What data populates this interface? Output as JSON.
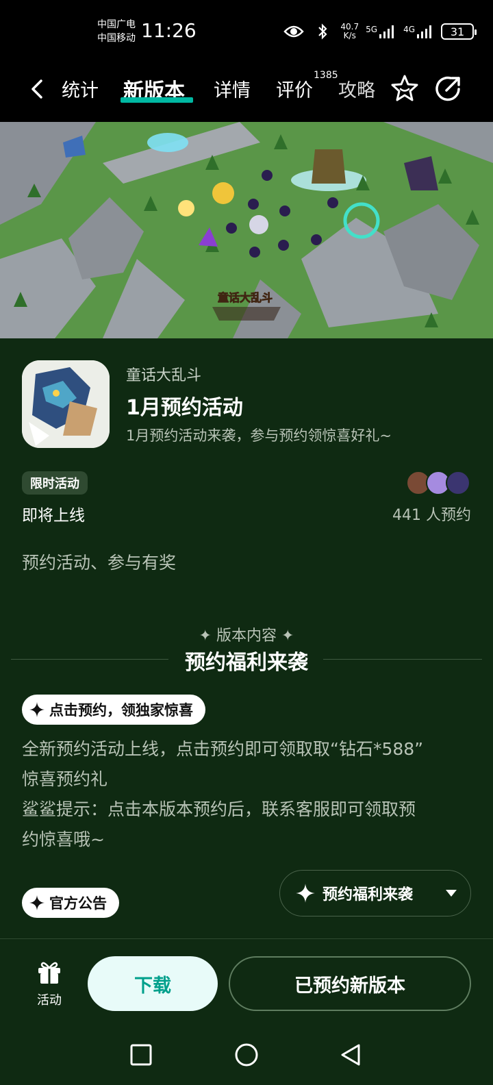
{
  "status_bar": {
    "carrier1": "中国广电",
    "carrier2": "中国移动",
    "time": "11:26",
    "net_speed_value": "40.7",
    "net_speed_unit": "K/s",
    "net1": "5G",
    "net2": "4G",
    "battery": "31"
  },
  "nav": {
    "tabs": [
      {
        "label": "统计"
      },
      {
        "label": "新版本"
      },
      {
        "label": "详情"
      },
      {
        "label": "评价"
      },
      {
        "label": "攻略"
      }
    ],
    "review_count": "1385",
    "accent": "#00b8a2"
  },
  "banner": {
    "logo_text": "童话大乱斗"
  },
  "app": {
    "game_name": "童话大乱斗",
    "event_title": "1月预约活动",
    "event_subtitle": "1月预约活动来袭，参与预约领惊喜好礼~"
  },
  "status": {
    "tag": "限时活动",
    "state": "即将上线",
    "reserve_count": "441 人预约"
  },
  "description": "预约活动、参与有奖",
  "section": {
    "pre_label": "版本内容",
    "title": "预约福利来袭"
  },
  "highlight": {
    "pill_label": "点击预约，领独家惊喜",
    "line1": "全新预约活动上线，点击预约即可领取取“钻石*588”",
    "line2": "惊喜预约礼",
    "line3": "鲨鲨提示：点击本版本预约后，联系客服即可领取预",
    "line4": "约惊喜哦~"
  },
  "announcement": {
    "pill_label": "官方公告",
    "dropdown_label": "预约福利来袭"
  },
  "bottom_bar": {
    "activity_label": "活动",
    "download_label": "下载",
    "reserved_label": "已预约新版本"
  }
}
